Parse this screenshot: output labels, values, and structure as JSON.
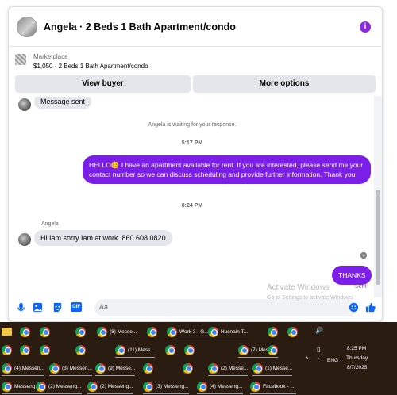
{
  "header": {
    "title": "Angela · 2 Beds 1 Bath Apartment/condo",
    "menu_glyph": "i"
  },
  "marketplace": {
    "label": "Marketplace",
    "listing": "$1,050 - 2 Beds 1 Bath Apartment/condo",
    "view_buyer": "View buyer",
    "more_options": "More options"
  },
  "messages": {
    "first_in": "Message sent",
    "waiting": "Angela is waiting for your response.",
    "time1": "5:17 PM",
    "out1": "HELLO😊 I have an apartment available for rent. If you are interested, please send me your contact number so we can discuss scheduling and provide further information. Thank you",
    "time2": "8:24 PM",
    "sender_name": "Angela",
    "in2": "Hi Iam sorry Iam at work. 860 608 0820",
    "out2": "THANKS",
    "sent_label": "Sent"
  },
  "composer": {
    "placeholder": "Aa",
    "gif_label": "GIF"
  },
  "watermark": {
    "line1": "Activate Windows",
    "line2": "Go to Settings to activate Windows."
  },
  "taskbar": {
    "row1": [
      {
        "icon": "folder-icon",
        "label": ""
      },
      {
        "icon": "chrome-icon",
        "label": ""
      },
      {
        "icon": "chrome-icon",
        "label": ""
      },
      {
        "icon": "chrome-icon",
        "label": ""
      },
      {
        "icon": "chrome-icon",
        "label": "(8) Messe..."
      },
      {
        "icon": "chrome-icon",
        "label": ""
      },
      {
        "icon": "chrome-icon",
        "label": "Work 3 - G..."
      },
      {
        "icon": "chrome-icon",
        "label": "Husnain T..."
      },
      {
        "icon": "chrome-icon",
        "label": ""
      },
      {
        "icon": "chrome-icon",
        "label": ""
      }
    ],
    "row2": [
      {
        "icon": "chrome-icon",
        "label": ""
      },
      {
        "icon": "chrome-icon",
        "label": ""
      },
      {
        "icon": "chrome-icon",
        "label": ""
      },
      {
        "icon": "chrome-icon",
        "label": ""
      },
      {
        "icon": "chrome-icon",
        "label": "(11) Mess..."
      },
      {
        "icon": "chrome-icon",
        "label": ""
      },
      {
        "icon": "chrome-icon",
        "label": ""
      },
      {
        "icon": "chrome-icon",
        "label": "(7) Messe..."
      },
      {
        "icon": "chrome-icon",
        "label": ""
      }
    ],
    "row3": [
      {
        "icon": "chrome-icon",
        "label": "(4) Messen..."
      },
      {
        "icon": "chrome-icon",
        "label": "(3) Messen..."
      },
      {
        "icon": "chrome-icon",
        "label": "(9) Messe..."
      },
      {
        "icon": "chrome-icon",
        "label": ""
      },
      {
        "icon": "chrome-icon",
        "label": ""
      },
      {
        "icon": "chrome-icon",
        "label": "(2) Messe..."
      },
      {
        "icon": "chrome-icon",
        "label": "(1) Messe..."
      }
    ],
    "row4": [
      {
        "icon": "chrome-icon",
        "label": "Messeng..."
      },
      {
        "icon": "chrome-icon",
        "label": "(2) Messeng..."
      },
      {
        "icon": "chrome-icon",
        "label": "(2) Messeng..."
      },
      {
        "icon": "chrome-icon",
        "label": "(3) Messeng..."
      },
      {
        "icon": "chrome-icon",
        "label": "(4) Messeng..."
      },
      {
        "icon": "chrome-icon",
        "label": "Facebook - I..."
      }
    ],
    "tray": {
      "lang": "ENG",
      "time": "8:25 PM",
      "day": "Thursday",
      "date": "8/7/2025"
    }
  }
}
